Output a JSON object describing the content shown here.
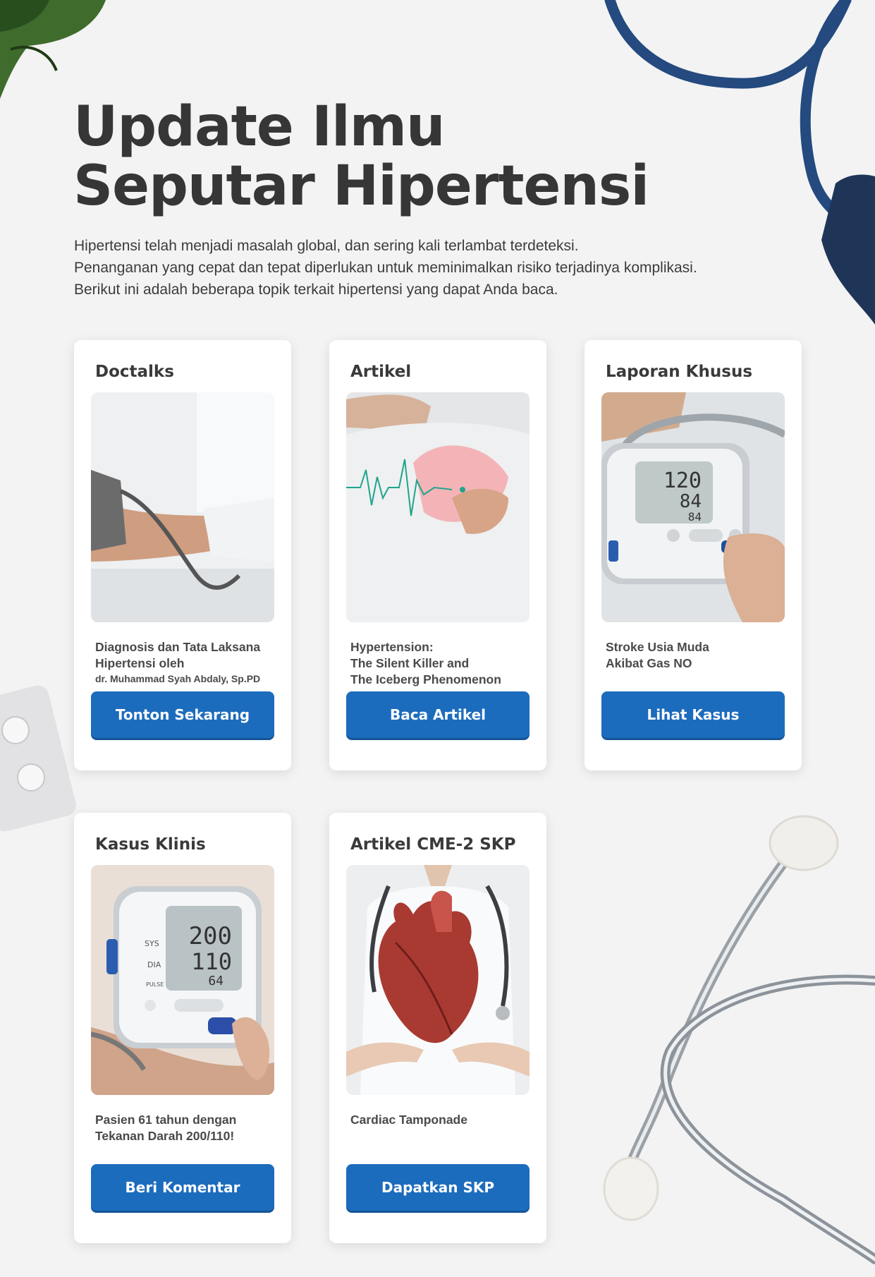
{
  "hero": {
    "title_line1": "Update Ilmu",
    "title_line2": "Seputar Hipertensi",
    "intro_lines": [
      "Hipertensi telah menjadi masalah global, dan sering kali terlambat terdeteksi.",
      "Penanganan yang cepat dan tepat diperlukan untuk meminimalkan risiko terjadinya komplikasi.",
      "Berikut ini adalah beberapa topik terkait hipertensi yang dapat Anda baca."
    ]
  },
  "cards": [
    {
      "title": "Doctalks",
      "desc": [
        "Diagnosis dan Tata Laksana",
        "Hipertensi oleh"
      ],
      "desc_small": "dr. Muhammad Syah Abdaly, Sp.PD",
      "button": "Tonton Sekarang"
    },
    {
      "title": "Artikel",
      "desc": [
        "Hypertension:",
        "The Silent Killer and",
        "The Iceberg Phenomenon"
      ],
      "button": "Baca Artikel"
    },
    {
      "title": "Laporan Khusus",
      "desc": [
        "Stroke Usia Muda",
        "Akibat Gas NO"
      ],
      "button": "Lihat Kasus",
      "monitor": {
        "sys": "120",
        "dia": "84",
        "pulse": "84"
      }
    },
    {
      "title": "Kasus Klinis",
      "desc": [
        "Pasien 61 tahun dengan",
        "Tekanan Darah 200/110!"
      ],
      "button": "Beri Komentar",
      "monitor": {
        "sys": "200",
        "dia": "110",
        "pulse": "64",
        "labels": [
          "SYS",
          "DIA",
          "PULSE"
        ]
      }
    },
    {
      "title": "Artikel CME-2 SKP",
      "desc": [
        "Cardiac Tamponade"
      ],
      "button": "Dapatkan SKP"
    }
  ],
  "colors": {
    "background": "#f3f3f3",
    "button": "#1c6cbd",
    "heading": "#363636",
    "stethoscope_tube": "#244a7f"
  },
  "icons": [
    "plant-leaves-decoration",
    "stethoscope-tube-decoration",
    "pill-blister-decoration",
    "stethoscope-metal-decoration"
  ]
}
